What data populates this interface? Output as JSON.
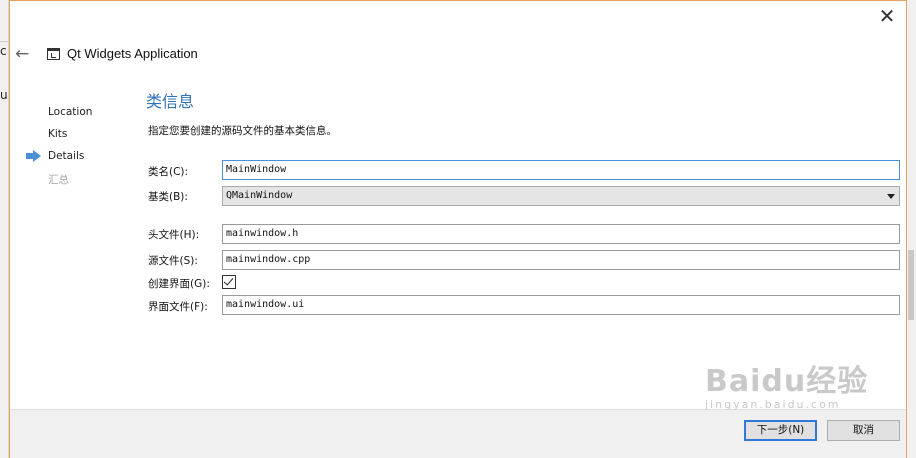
{
  "background_app": {
    "fragment_top": "c",
    "fragment_mid": "u"
  },
  "wizard": {
    "title": "Qt Widgets Application"
  },
  "steps": [
    {
      "label": "Location",
      "state": "done"
    },
    {
      "label": "Kits",
      "state": "done"
    },
    {
      "label": "Details",
      "state": "current"
    },
    {
      "label": "汇总",
      "state": "pending"
    }
  ],
  "page": {
    "title": "类信息",
    "subtitle": "指定您要创建的源码文件的基本类信息。"
  },
  "form": {
    "class_name_label": "类名(C):",
    "class_name_value": "MainWindow",
    "base_class_label": "基类(B):",
    "base_class_value": "QMainWindow",
    "header_label": "头文件(H):",
    "header_value": "mainwindow.h",
    "source_label": "源文件(S):",
    "source_value": "mainwindow.cpp",
    "gen_form_label": "创建界面(G):",
    "gen_form_checked": true,
    "form_file_label": "界面文件(F):",
    "form_file_value": "mainwindow.ui"
  },
  "buttons": {
    "next": "下一步(N)",
    "cancel": "取消"
  },
  "watermark": {
    "text": "Baidu经验",
    "url_text": "jingyan.baidu.com"
  },
  "colors": {
    "accent": "#2f72b8",
    "step_arrow": "#4d8fd6",
    "frame": "#e8a25c"
  }
}
